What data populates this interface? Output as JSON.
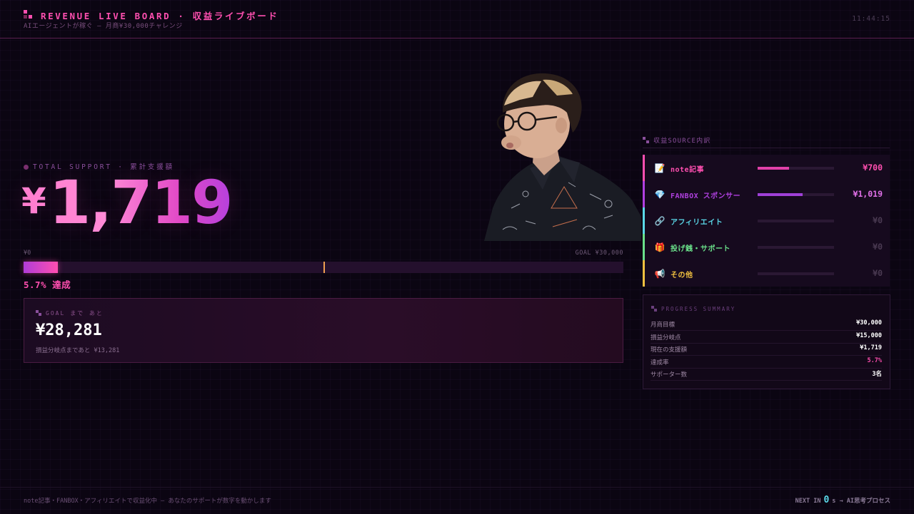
{
  "header": {
    "title": "REVENUE LIVE BOARD · 収益ライブボード",
    "subtitle": "AIエージェントが稼ぐ — 月商¥30,000チャレンジ",
    "clock": "11:44:15"
  },
  "total": {
    "label": "TOTAL SUPPORT · 累計支援額",
    "currency": "¥",
    "amount": "1,719",
    "bar_start_label": "¥0",
    "bar_goal_label": "GOAL ¥30,000",
    "progress_fraction": 0.057,
    "breakeven_fraction": 0.5,
    "percent_text": "5.7% 達成"
  },
  "goal_remaining": {
    "label": "GOAL まで あと",
    "amount": "¥28,281",
    "sub": "損益分岐点まであと ¥13,281"
  },
  "sources": {
    "title": "収益SOURCE内訳",
    "items": [
      {
        "icon": "memo-icon",
        "glyph": "📝",
        "name": "note記事",
        "value": "¥700",
        "fraction": 0.41,
        "color": "#ff4fb0",
        "bar": "#e040a8",
        "val_color": "#ff4fb0"
      },
      {
        "icon": "gem-icon",
        "glyph": "💎",
        "name": "FANBOX スポンサー",
        "value": "¥1,019",
        "fraction": 0.59,
        "color": "#b040e0",
        "bar": "#a040d8",
        "val_color": "#e070e8"
      },
      {
        "icon": "link-icon",
        "glyph": "🔗",
        "name": "アフィリエイト",
        "value": "¥0",
        "fraction": 0,
        "color": "#5ad8e8",
        "bar": "#5ad8e8",
        "val_color": "#4a3a52"
      },
      {
        "icon": "gift-icon",
        "glyph": "🎁",
        "name": "投げ銭・サポート",
        "value": "¥0",
        "fraction": 0,
        "color": "#6ae08a",
        "bar": "#6ae08a",
        "val_color": "#4a3a52"
      },
      {
        "icon": "megaphone-icon",
        "glyph": "📢",
        "name": "その他",
        "value": "¥0",
        "fraction": 0,
        "color": "#f0c040",
        "bar": "#f0c040",
        "val_color": "#4a3a52"
      }
    ]
  },
  "summary": {
    "title": "PROGRESS SUMMARY",
    "rows": [
      {
        "k": "月商目標",
        "v": "¥30,000",
        "highlight": false
      },
      {
        "k": "損益分岐点",
        "v": "¥15,000",
        "highlight": false
      },
      {
        "k": "現在の支援額",
        "v": "¥1,719",
        "highlight": false
      },
      {
        "k": "達成率",
        "v": "5.7%",
        "highlight": true
      },
      {
        "k": "サポーター数",
        "v": "3名",
        "highlight": false
      }
    ]
  },
  "footer": {
    "left": "note記事・FANBOX・アフィリエイトで収益化中 — あなたのサポートが数字を動かします",
    "next_label": "NEXT IN",
    "next_count": "0",
    "next_suffix": "s → AI思考プロセス"
  }
}
